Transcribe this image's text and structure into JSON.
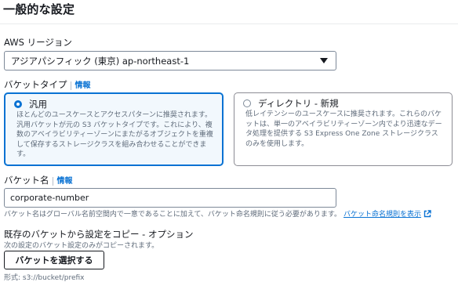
{
  "section": {
    "title": "一般的な設定"
  },
  "region": {
    "label": "AWS リージョン",
    "value": "アジアパシフィック (東京) ap-northeast-1"
  },
  "bucket_type": {
    "label": "バケットタイプ",
    "info": "情報",
    "options": [
      {
        "title": "汎用",
        "description": "ほとんどのユースケースとアクセスパターンに推奨されます。汎用バケットが元の S3 バケットタイプです。これにより、複数のアベイラビリティーゾーンにまたがるオブジェクトを重複して保存するストレージクラスを組み合わせることができます。",
        "selected": true
      },
      {
        "title": "ディレクトリ - 新規",
        "description": "低レイテンシーのユースケースに推奨されます。これらのバケットは、単一のアベイラビリティーゾーン内でより迅速なデータ処理を提供する S3 Express One Zone ストレージクラスのみを使用します。",
        "selected": false
      }
    ]
  },
  "bucket_name": {
    "label": "バケット名",
    "info": "情報",
    "value": "corporate-number",
    "hint": "バケット名はグローバル名前空間内で一意であることに加えて、バケット命名規則に従う必要があります。",
    "rules_link": "バケット命名規則を表示"
  },
  "copy_settings": {
    "title": "既存のバケットから設定をコピー - オプション",
    "description": "次の設定のバケット設定のみがコピーされます。",
    "button": "バケットを選択する",
    "format": "形式: s3://bucket/prefix"
  },
  "colors": {
    "accent": "#0972d3",
    "text": "#16191f",
    "muted": "#5f6b7a"
  },
  "icons": {
    "region_dropdown": "caret-down-icon",
    "external_link": "external-link-icon"
  }
}
